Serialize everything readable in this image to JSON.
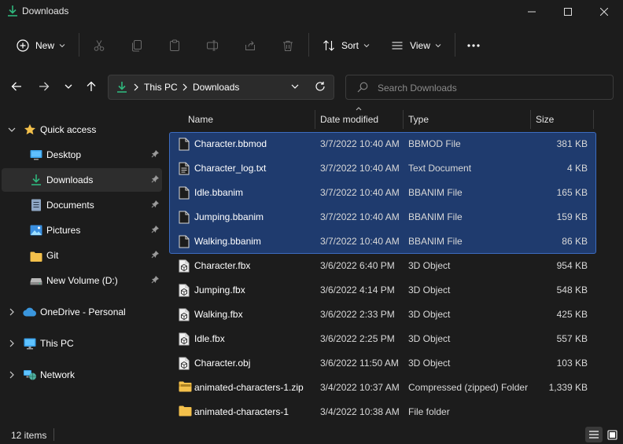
{
  "window": {
    "title": "Downloads"
  },
  "commandbar": {
    "new_label": "New",
    "sort_label": "Sort",
    "view_label": "View"
  },
  "address": {
    "crumbs": [
      "This PC",
      "Downloads"
    ]
  },
  "search": {
    "placeholder": "Search Downloads"
  },
  "sidebar": {
    "quick_access": "Quick access",
    "items": [
      {
        "label": "Desktop",
        "icon": "desktop-icon",
        "pinned": true
      },
      {
        "label": "Downloads",
        "icon": "download-icon",
        "pinned": true
      },
      {
        "label": "Documents",
        "icon": "document-icon",
        "pinned": true
      },
      {
        "label": "Pictures",
        "icon": "pictures-icon",
        "pinned": true
      },
      {
        "label": "Git",
        "icon": "folder-icon",
        "pinned": true
      },
      {
        "label": "New Volume (D:)",
        "icon": "drive-icon",
        "pinned": true
      }
    ],
    "onedrive": "OneDrive - Personal",
    "thispc": "This PC",
    "network": "Network"
  },
  "columns": {
    "name": "Name",
    "date": "Date modified",
    "type": "Type",
    "size": "Size"
  },
  "files": [
    {
      "name": "Character.bbmod",
      "date": "3/7/2022 10:40 AM",
      "type": "BBMOD File",
      "size": "381 KB",
      "icon": "file-icon",
      "selected": true
    },
    {
      "name": "Character_log.txt",
      "date": "3/7/2022 10:40 AM",
      "type": "Text Document",
      "size": "4 KB",
      "icon": "text-file-icon",
      "selected": true
    },
    {
      "name": "Idle.bbanim",
      "date": "3/7/2022 10:40 AM",
      "type": "BBANIM File",
      "size": "165 KB",
      "icon": "file-icon",
      "selected": true
    },
    {
      "name": "Jumping.bbanim",
      "date": "3/7/2022 10:40 AM",
      "type": "BBANIM File",
      "size": "159 KB",
      "icon": "file-icon",
      "selected": true
    },
    {
      "name": "Walking.bbanim",
      "date": "3/7/2022 10:40 AM",
      "type": "BBANIM File",
      "size": "86 KB",
      "icon": "file-icon",
      "selected": true
    },
    {
      "name": "Character.fbx",
      "date": "3/6/2022 6:40 PM",
      "type": "3D Object",
      "size": "954 KB",
      "icon": "3d-object-icon",
      "selected": false
    },
    {
      "name": "Jumping.fbx",
      "date": "3/6/2022 4:14 PM",
      "type": "3D Object",
      "size": "548 KB",
      "icon": "3d-object-icon",
      "selected": false
    },
    {
      "name": "Walking.fbx",
      "date": "3/6/2022 2:33 PM",
      "type": "3D Object",
      "size": "425 KB",
      "icon": "3d-object-icon",
      "selected": false
    },
    {
      "name": "Idle.fbx",
      "date": "3/6/2022 2:25 PM",
      "type": "3D Object",
      "size": "557 KB",
      "icon": "3d-object-icon",
      "selected": false
    },
    {
      "name": "Character.obj",
      "date": "3/6/2022 11:50 AM",
      "type": "3D Object",
      "size": "103 KB",
      "icon": "3d-object-icon",
      "selected": false
    },
    {
      "name": "animated-characters-1.zip",
      "date": "3/4/2022 10:37 AM",
      "type": "Compressed (zipped) Folder",
      "size": "1,339 KB",
      "icon": "zip-folder-icon",
      "selected": false
    },
    {
      "name": "animated-characters-1",
      "date": "3/4/2022 10:38 AM",
      "type": "File folder",
      "size": "",
      "icon": "folder-icon",
      "selected": false
    }
  ],
  "status": {
    "count": "12 items"
  },
  "colors": {
    "background": "#1c1c1c",
    "selection": "#1f3b6e",
    "selection_border": "#3d6cc0",
    "accent_green": "#2fb67c",
    "folder_yellow": "#f3c04b"
  }
}
